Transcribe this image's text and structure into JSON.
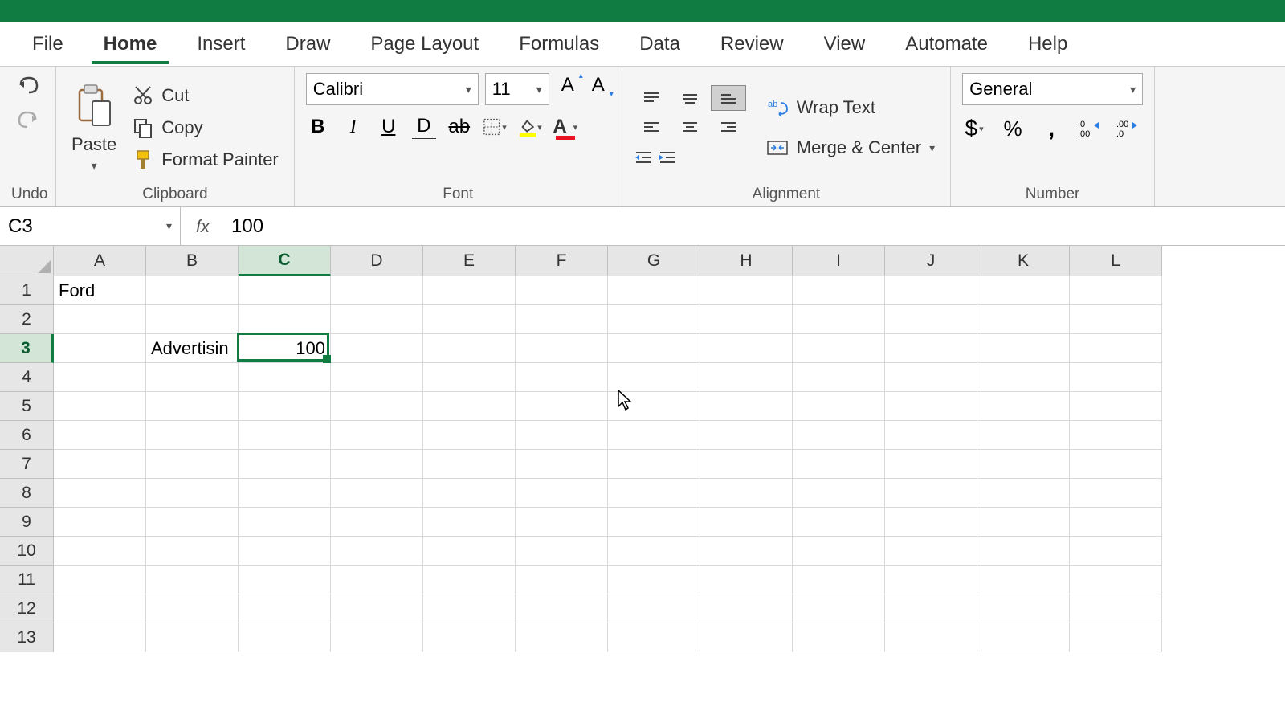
{
  "tabs": [
    "File",
    "Home",
    "Insert",
    "Draw",
    "Page Layout",
    "Formulas",
    "Data",
    "Review",
    "View",
    "Automate",
    "Help"
  ],
  "active_tab": 1,
  "clipboard": {
    "paste": "Paste",
    "cut": "Cut",
    "copy": "Copy",
    "format_painter": "Format Painter",
    "label": "Clipboard"
  },
  "undo": {
    "label": "Undo"
  },
  "font": {
    "name": "Calibri",
    "size": "11",
    "label": "Font"
  },
  "alignment": {
    "wrap": "Wrap Text",
    "merge": "Merge & Center",
    "label": "Alignment"
  },
  "number": {
    "format": "General",
    "label": "Number"
  },
  "name_box": "C3",
  "formula_value": "100",
  "columns": [
    "A",
    "B",
    "C",
    "D",
    "E",
    "F",
    "G",
    "H",
    "I",
    "J",
    "K",
    "L"
  ],
  "selected_col": 2,
  "rows": [
    1,
    2,
    3,
    4,
    5,
    6,
    7,
    8,
    9,
    10,
    11,
    12,
    13
  ],
  "selected_row": 2,
  "cells": {
    "A1": "Ford",
    "B3": "Advertisin",
    "C3": "100"
  },
  "selection": {
    "col": 2,
    "row": 2
  }
}
